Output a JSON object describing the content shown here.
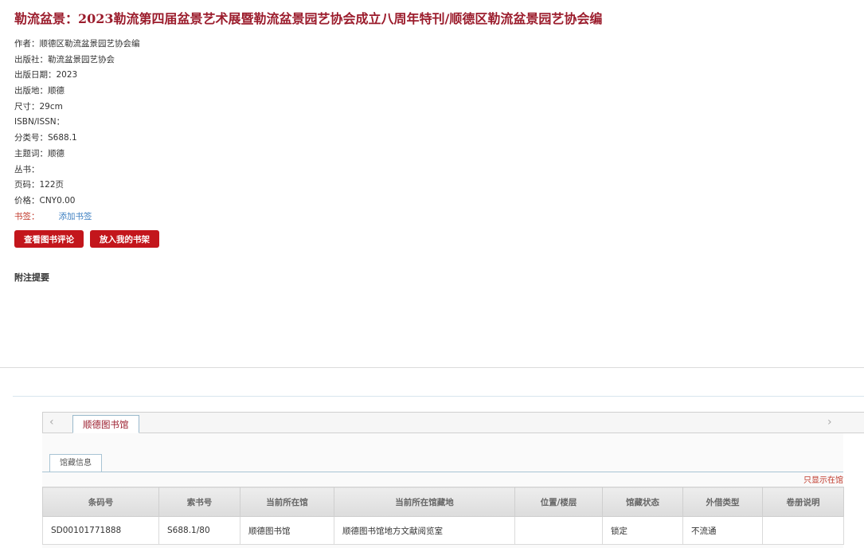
{
  "book": {
    "title": "勒流盆景：2023勒流第四届盆景艺术展暨勒流盆景园艺协会成立八周年特刊/顺德区勒流盆景园艺协会编"
  },
  "meta": [
    {
      "label": "作者：",
      "value": "顺德区勒流盆景园艺协会编"
    },
    {
      "label": "出版社：",
      "value": "勒流盆景园艺协会"
    },
    {
      "label": "出版日期：",
      "value": "2023"
    },
    {
      "label": "出版地：",
      "value": "顺德"
    },
    {
      "label": "尺寸：",
      "value": "29cm"
    },
    {
      "label": "ISBN/ISSN：",
      "value": ""
    },
    {
      "label": "分类号：",
      "value": "S688.1"
    },
    {
      "label": "主题词：",
      "value": "顺德"
    },
    {
      "label": "丛书：",
      "value": ""
    },
    {
      "label": "页码：",
      "value": "122页"
    },
    {
      "label": "价格：",
      "value": "CNY0.00"
    }
  ],
  "bookmark": {
    "label": "书签：",
    "link": "添加书签"
  },
  "buttons": {
    "review": "查看图书评论",
    "shelf": "放入我的书架"
  },
  "notes_title": "附注提要",
  "tabs": {
    "arrow_left": "‹",
    "arrow_right": "›",
    "library": "顺德图书馆",
    "holdings_tab": "馆藏信息",
    "only_in_library": "只显示在馆"
  },
  "table": {
    "headers": [
      "条码号",
      "索书号",
      "当前所在馆",
      "当前所在馆藏地",
      "位置/楼层",
      "馆藏状态",
      "外借类型",
      "卷册说明"
    ],
    "rows": [
      [
        "SD00101771888",
        "S688.1/80",
        "顺德图书馆",
        "顺德图书馆地方文献阅览室",
        "",
        "锁定",
        "不流通",
        ""
      ]
    ]
  },
  "colors": {
    "accent": "#9b1c2c",
    "button": "#c3161c",
    "link": "#3d7fc1"
  }
}
